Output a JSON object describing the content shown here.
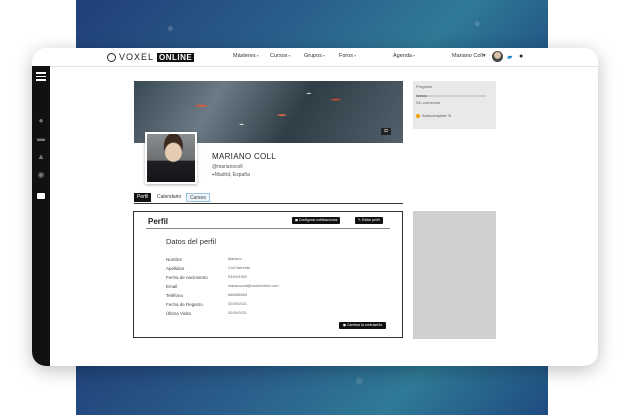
{
  "brand": {
    "part1": "VOXEL",
    "part2": "ONLINE"
  },
  "nav": [
    {
      "label": "Másteres",
      "left": 0
    },
    {
      "label": "Cursos"
    },
    {
      "label": "Grupos"
    },
    {
      "label": "Foros"
    },
    {
      "label": "Agenda"
    }
  ],
  "user": {
    "name": "Mariano Coll"
  },
  "profile": {
    "name": "MARIANO COLL",
    "handle": "@marianocoll",
    "location": "Madrid, España"
  },
  "tabs": [
    "Perfil",
    "Calendario",
    "Cursos"
  ],
  "panel": {
    "title": "Perfil",
    "btn_notifications": "Configurar notificaciones",
    "btn_edit": "Editar perfil",
    "section_title": "Datos del perfil",
    "fields": [
      {
        "label": "Nombre",
        "value": "Mariano"
      },
      {
        "label": "Apellidos",
        "value": "Coll Valverde"
      },
      {
        "label": "Fecha de nacimiento",
        "value": "03/09/1992"
      },
      {
        "label": "Email",
        "value": "marianocoll@voxelonline.com"
      },
      {
        "label": "Teléfono",
        "value": "666666964"
      },
      {
        "label": "Fecha de Registro",
        "value": "02/09/2021"
      },
      {
        "label": "Última Visita",
        "value": "02/09/2021"
      }
    ],
    "save_label": "Cambiar la contraseña"
  },
  "side": {
    "progress_label": "Progreso",
    "progress_sub": "Sin comenzar",
    "progress_value": 0.15,
    "item_label": "Autocomplete %"
  },
  "icons": [
    "menu-icon",
    "user-icon",
    "folder-icon",
    "flask-icon",
    "chat-icon",
    "video-icon",
    "camera-icon",
    "pin-icon",
    "bell-icon",
    "cart-icon"
  ],
  "colors": {
    "accent_dark": "#111111",
    "band": "#2a5d8a",
    "progress_dot": "#f2a100"
  }
}
